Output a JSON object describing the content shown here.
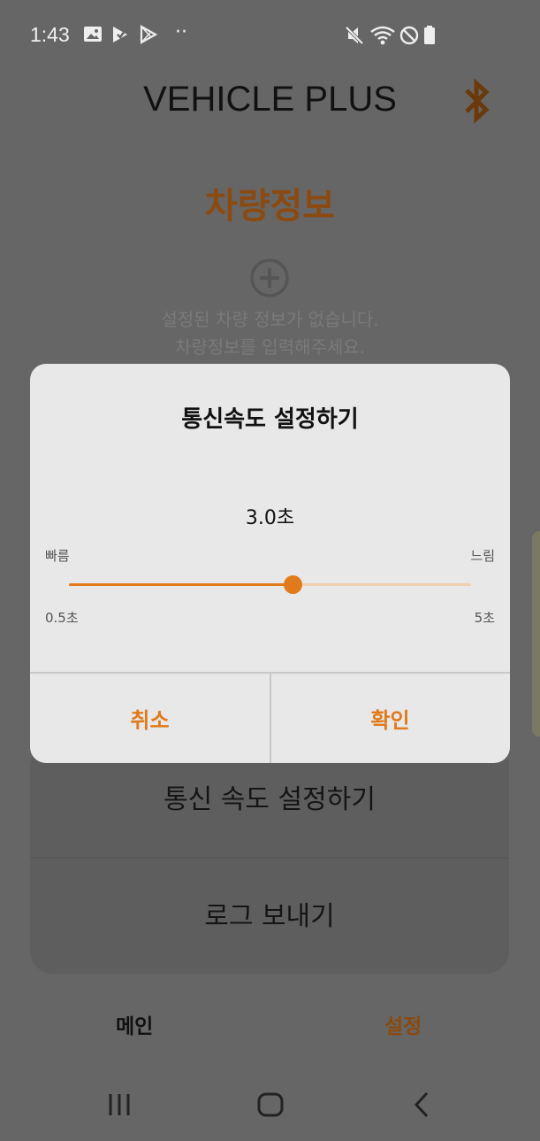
{
  "status_bar": {
    "time": "1:43",
    "dots": "··"
  },
  "header": {
    "app_title": "VEHICLE PLUS",
    "bluetooth_icon": "bluetooth-icon"
  },
  "vehicle_section": {
    "title": "차량정보",
    "empty_line1": "설정된 차량 정보가 없습니다.",
    "empty_line2": "차량정보를 입력해주세요."
  },
  "dialog": {
    "title": "통신속도 설정하기",
    "value": "3.0초",
    "fast_label": "빠름",
    "slow_label": "느림",
    "min_label": "0.5초",
    "max_label": "5초",
    "slider": {
      "min": 0.5,
      "max": 5,
      "value": 3.0
    },
    "cancel_label": "취소",
    "confirm_label": "확인"
  },
  "settings_menu": {
    "items": [
      {
        "label": "통신 속도 설정하기"
      },
      {
        "label": "로그 보내기"
      }
    ]
  },
  "bottom_nav": {
    "main_label": "메인",
    "settings_label": "설정"
  },
  "colors": {
    "accent": "#e07a1a",
    "accent_dark": "#8a4a10",
    "overlay_bg": "#666666",
    "dialog_bg": "#e8e8e8"
  }
}
